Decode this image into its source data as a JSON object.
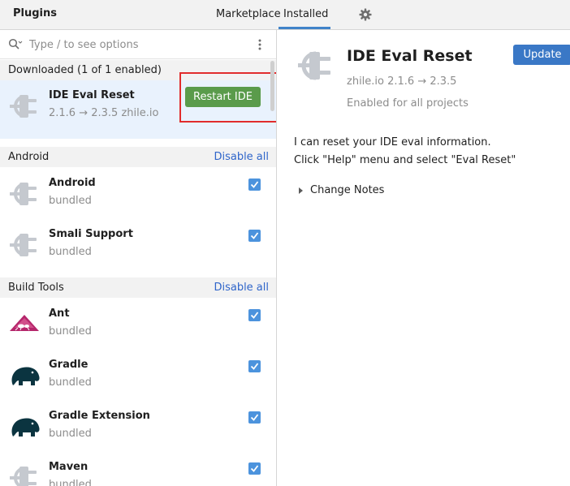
{
  "header": {
    "title": "Plugins",
    "tabs": [
      {
        "label": "Marketplace"
      },
      {
        "label": "Installed"
      }
    ],
    "settings_icon": "gear-icon"
  },
  "search": {
    "placeholder": "Type / to see options",
    "icon": "search-icon",
    "menu_icon": "kebab-menu-icon"
  },
  "sections": [
    {
      "name": "Downloaded (1 of 1 enabled)",
      "action": "",
      "plugins": [
        {
          "name": "IDE Eval Reset",
          "sub": "2.1.6 → 2.3.5  zhile.io",
          "button": "Restart IDE",
          "icon": "plug-icon"
        }
      ]
    },
    {
      "name": "Android",
      "action": "Disable all",
      "plugins": [
        {
          "name": "Android",
          "sub": "bundled",
          "icon": "plug-icon",
          "checked": true
        },
        {
          "name": "Smali Support",
          "sub": "bundled",
          "icon": "plug-icon",
          "checked": true
        }
      ]
    },
    {
      "name": "Build Tools",
      "action": "Disable all",
      "plugins": [
        {
          "name": "Ant",
          "sub": "bundled",
          "icon": "ant-icon",
          "checked": true
        },
        {
          "name": "Gradle",
          "sub": "bundled",
          "icon": "elephant-icon",
          "checked": true
        },
        {
          "name": "Gradle Extension",
          "sub": "bundled",
          "icon": "elephant-icon",
          "checked": true
        },
        {
          "name": "Maven",
          "sub": "bundled",
          "icon": "plug-icon",
          "checked": true
        }
      ]
    }
  ],
  "details": {
    "title": "IDE Eval Reset",
    "meta": "zhile.io   2.1.6 → 2.3.5",
    "status": "Enabled for all projects",
    "update_label": "Update",
    "description_lines": [
      "I can reset your IDE eval information.",
      "Click \"Help\" menu and select \"Eval Reset\""
    ],
    "change_notes_label": "Change Notes"
  },
  "colors": {
    "accent": "#4083c9",
    "restart_button": "#5a9b4b",
    "update_button": "#3a78c6",
    "highlight_box": "#e12c2c",
    "selected_row": "#e9f2fd",
    "link": "#2f65ca"
  }
}
